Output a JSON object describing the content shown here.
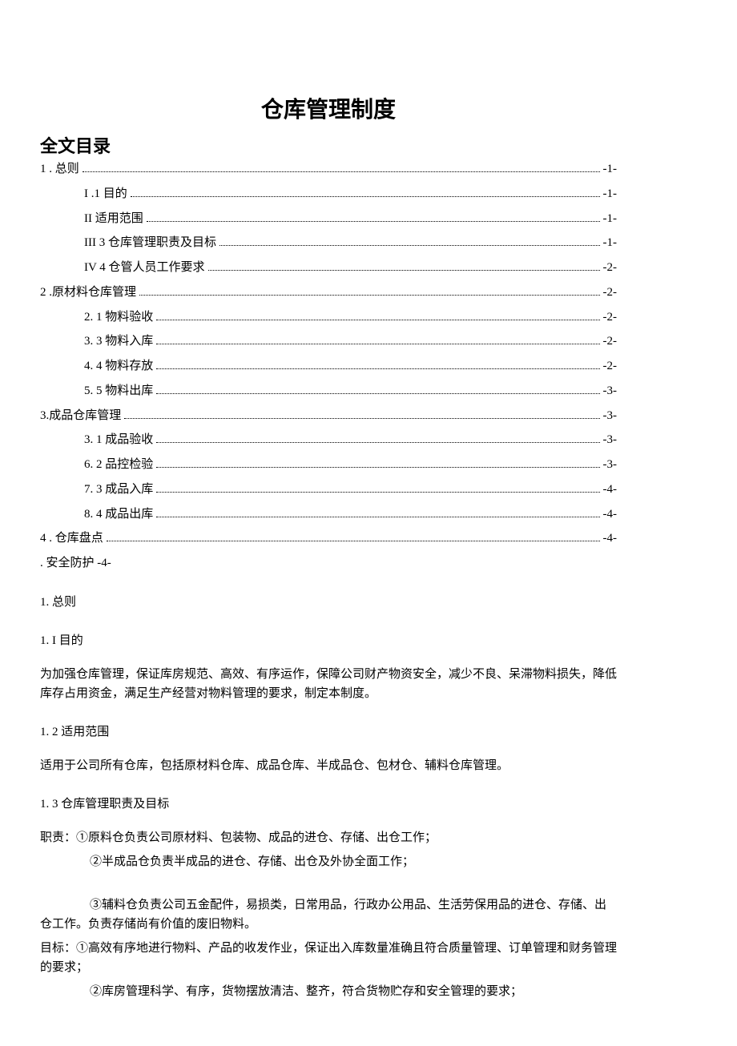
{
  "title": "仓库管理制度",
  "toc_title": "全文目录",
  "toc": [
    {
      "level": "top",
      "label": "1 . 总则",
      "page": "-1-"
    },
    {
      "level": "sub",
      "label": "I   .1 目的",
      "page": "-1-"
    },
    {
      "level": "sub",
      "label": "II      适用范围 ",
      "page": "-1-"
    },
    {
      "level": "sub",
      "label": "III  3 仓库管理职责及目标 ",
      "page": "-1-"
    },
    {
      "level": "sub",
      "label": "IV  4 仓管人员工作要求 ",
      "page": "-2-"
    },
    {
      "level": "top",
      "label": "2   .原材料仓库管理",
      "page": "-2-"
    },
    {
      "level": "sub",
      "label": "2.   1 物料验收 ",
      "page": "-2-"
    },
    {
      "level": "sub",
      "label": "3.   3 物料入库 ",
      "page": "-2-"
    },
    {
      "level": "sub",
      "label": "4.   4 物料存放 ",
      "page": "-2-"
    },
    {
      "level": "sub",
      "label": "5.   5 物料出库 ",
      "page": "-3-"
    },
    {
      "level": "top",
      "label": "3.成品仓库管理 ",
      "page": "-3-"
    },
    {
      "level": "sub",
      "label": "3.   1 成品验收 ",
      "page": "-3-"
    },
    {
      "level": "sub",
      "label": "6.   2 品控检验 ",
      "page": "-3-"
    },
    {
      "level": "sub",
      "label": "7.   3 成品入库 ",
      "page": "-4-"
    },
    {
      "level": "sub",
      "label": "8.   4 成品出库 ",
      "page": "-4-"
    },
    {
      "level": "top",
      "label": "4  . 仓库盘点",
      "page": "-4-"
    }
  ],
  "toc_plain": ". 安全防护      -4-",
  "sections": {
    "s1": "1. 总则",
    "s1_1": "1. I 目的",
    "p1_1": "为加强仓库管理，保证库房规范、高效、有序运作，保障公司财产物资安全，减少不良、呆滞物料损失，降低库存占用资金，满足生产经营对物料管理的要求，制定本制度。",
    "s1_2": "1. 2 适用范围",
    "p1_2": "适用于公司所有仓库，包括原材料仓库、成品仓库、半成品仓、包材仓、辅料仓库管理。",
    "s1_3": "1. 3 仓库管理职责及目标",
    "p1_3a": "职责：①原料仓负责公司原材料、包装物、成品的进仓、存储、出仓工作；",
    "p1_3b": "②半成品仓负责半成品的进仓、存储、出仓及外协全面工作；",
    "p1_3c": "③辅料仓负责公司五金配件，易损类，日常用品，行政办公用品、生活劳保用品的进仓、存储、出仓工作。负责存储尚有价值的废旧物料。",
    "p1_3d": "目标：①高效有序地进行物料、产品的收发作业，保证出入库数量准确且符合质量管理、订单管理和财务管理的要求；",
    "p1_3e": "②库房管理科学、有序，货物摆放清洁、整齐，符合货物贮存和安全管理的要求；"
  }
}
